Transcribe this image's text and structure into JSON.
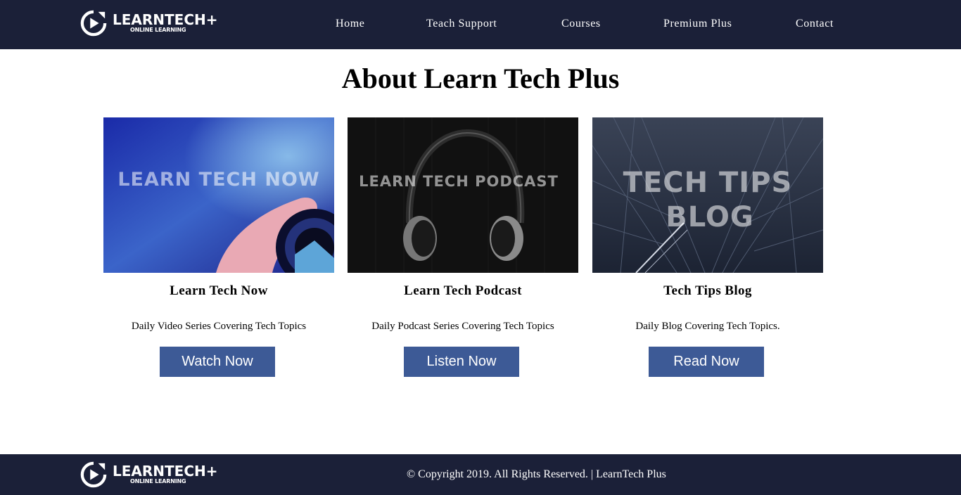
{
  "brand": {
    "name": "LEARNTECH+",
    "tagline": "ONLINE LEARNING"
  },
  "nav": {
    "items": [
      {
        "label": "Home"
      },
      {
        "label": "Teach Support"
      },
      {
        "label": "Courses"
      },
      {
        "label": "Premium Plus"
      },
      {
        "label": "Contact"
      }
    ]
  },
  "main": {
    "title": "About Learn Tech Plus",
    "cards": [
      {
        "image_text": "LEARN TECH NOW",
        "title": "Learn Tech Now",
        "description": "Daily Video Series Covering Tech Topics",
        "button": "Watch Now"
      },
      {
        "image_text": "LEARN TECH PODCAST",
        "title": "Learn Tech Podcast",
        "description": "Daily Podcast Series Covering Tech Topics",
        "button": "Listen Now"
      },
      {
        "image_text_line1": "TECH TIPS",
        "image_text_line2": "BLOG",
        "title": "Tech Tips Blog",
        "description": "Daily Blog Covering Tech Topics.",
        "button": "Read Now"
      }
    ]
  },
  "footer": {
    "copyright": "© Copyright 2019. All Rights Reserved. | LearnTech Plus"
  },
  "colors": {
    "header_bg": "#1b2038",
    "button_bg": "#3d5a96",
    "text": "#000000",
    "light_text": "#ffffff"
  }
}
